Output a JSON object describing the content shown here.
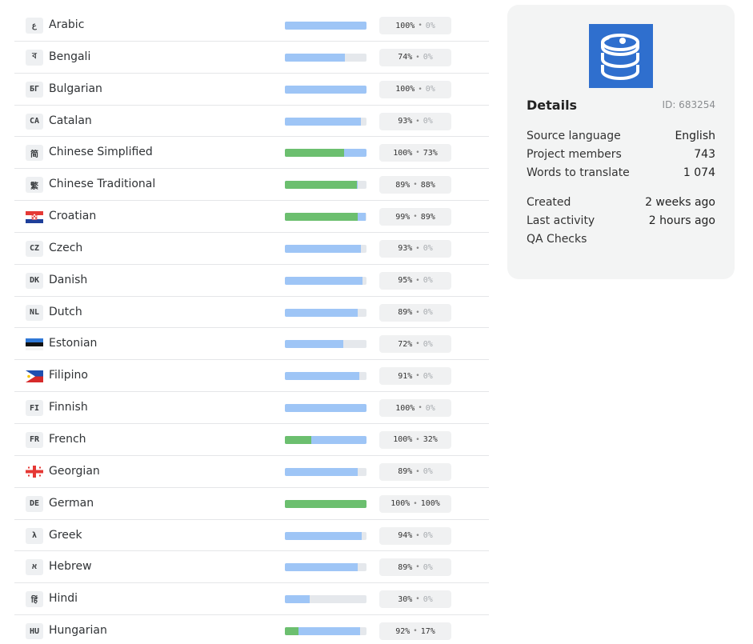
{
  "details": {
    "title": "Details",
    "id_label": "ID: 683254",
    "source_language_label": "Source language",
    "source_language": "English",
    "members_label": "Project members",
    "members": "743",
    "words_label": "Words to translate",
    "words": "1 074",
    "created_label": "Created",
    "created": "2 weeks ago",
    "last_activity_label": "Last activity",
    "last_activity": "2 hours ago",
    "qa_label": "QA Checks"
  },
  "languages": [
    {
      "badge": "ع",
      "flag": "",
      "name": "Arabic",
      "translated": 100,
      "approved": 0
    },
    {
      "badge": "ব",
      "flag": "",
      "name": "Bengali",
      "translated": 74,
      "approved": 0
    },
    {
      "badge": "БГ",
      "flag": "",
      "name": "Bulgarian",
      "translated": 100,
      "approved": 0
    },
    {
      "badge": "CA",
      "flag": "",
      "name": "Catalan",
      "translated": 93,
      "approved": 0
    },
    {
      "badge": "简",
      "flag": "",
      "name": "Chinese Simplified",
      "translated": 100,
      "approved": 73
    },
    {
      "badge": "繁",
      "flag": "",
      "name": "Chinese Traditional",
      "translated": 89,
      "approved": 88
    },
    {
      "badge": "",
      "flag": "croatia",
      "name": "Croatian",
      "translated": 99,
      "approved": 89
    },
    {
      "badge": "CZ",
      "flag": "",
      "name": "Czech",
      "translated": 93,
      "approved": 0
    },
    {
      "badge": "DK",
      "flag": "",
      "name": "Danish",
      "translated": 95,
      "approved": 0
    },
    {
      "badge": "NL",
      "flag": "",
      "name": "Dutch",
      "translated": 89,
      "approved": 0
    },
    {
      "badge": "",
      "flag": "estonia",
      "name": "Estonian",
      "translated": 72,
      "approved": 0
    },
    {
      "badge": "",
      "flag": "philippines",
      "name": "Filipino",
      "translated": 91,
      "approved": 0
    },
    {
      "badge": "FI",
      "flag": "",
      "name": "Finnish",
      "translated": 100,
      "approved": 0
    },
    {
      "badge": "FR",
      "flag": "",
      "name": "French",
      "translated": 100,
      "approved": 32
    },
    {
      "badge": "",
      "flag": "georgia",
      "name": "Georgian",
      "translated": 89,
      "approved": 0
    },
    {
      "badge": "DE",
      "flag": "",
      "name": "German",
      "translated": 100,
      "approved": 100
    },
    {
      "badge": "λ",
      "flag": "",
      "name": "Greek",
      "translated": 94,
      "approved": 0
    },
    {
      "badge": "א",
      "flag": "",
      "name": "Hebrew",
      "translated": 89,
      "approved": 0
    },
    {
      "badge": "हिं",
      "flag": "",
      "name": "Hindi",
      "translated": 30,
      "approved": 0
    },
    {
      "badge": "HU",
      "flag": "",
      "name": "Hungarian",
      "translated": 92,
      "approved": 17
    }
  ],
  "colors": {
    "translated_bar": "#9ec5f6",
    "approved_bar": "#6cbf6f",
    "bar_track": "#e5e8ec",
    "logo_bg": "#2f6fce"
  },
  "icons": {
    "logo": "database-stack-icon"
  }
}
